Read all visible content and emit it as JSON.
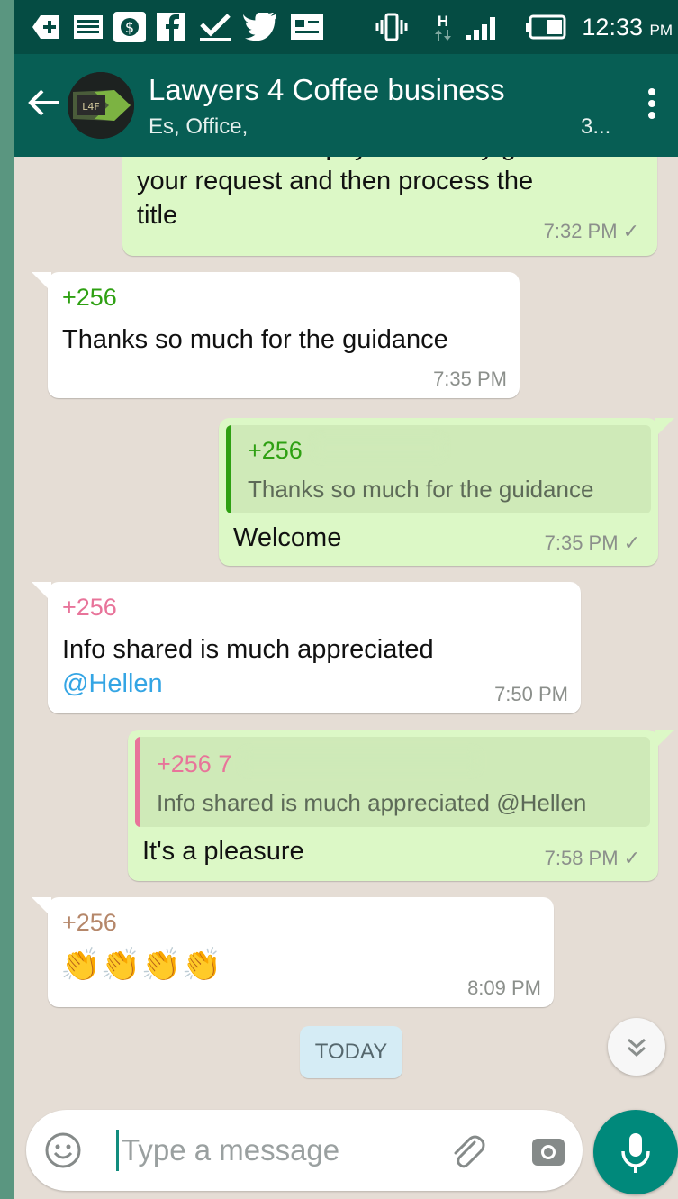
{
  "status_bar": {
    "icons": [
      "add-box-icon",
      "message-icon",
      "dollar-app-icon",
      "facebook-icon",
      "download-done-icon",
      "twitter-icon",
      "news-icon",
      "vibrate-icon",
      "h-network-icon",
      "signal-icon",
      "battery-icon"
    ],
    "network_label": "H",
    "time": "12:33",
    "ampm": "PM"
  },
  "header": {
    "title": "Lawyers 4 Coffee business",
    "subtitle": "Es, Office,",
    "subtitle_tail": "3...",
    "avatar_text": "L4F"
  },
  "messages": [
    {
      "type": "outgoing",
      "text_lines": [
        "assess the fees payable if they grant",
        "your request and then process the",
        "title"
      ],
      "time": "7:32 PM"
    },
    {
      "type": "incoming",
      "sender": "+256",
      "text": "Thanks so much for the guidance",
      "time": "7:35 PM"
    },
    {
      "type": "outgoing",
      "quote_sender": "+256",
      "quote_text": "Thanks so much for the guidance",
      "text": "Welcome",
      "time": "7:35 PM"
    },
    {
      "type": "incoming",
      "sender": "+256",
      "text": "Info shared is much appreciated",
      "mention": "@Hellen",
      "time": "7:50 PM"
    },
    {
      "type": "outgoing",
      "quote_sender": "+256 7",
      "quote_text": "Info shared is much appreciated @Hellen",
      "text": "It's a pleasure",
      "time": "7:58 PM"
    },
    {
      "type": "incoming",
      "sender": "+256",
      "emoji": "👏👏👏👏",
      "time": "8:09 PM"
    }
  ],
  "day_separator": "TODAY",
  "composer": {
    "placeholder": "Type a message"
  },
  "colors": {
    "header": "#075e54",
    "status_bar": "#054c43",
    "outgoing_bubble": "#dcf8c6",
    "incoming_bubble": "#ffffff",
    "chat_bg": "#e5ddd5",
    "mic_button": "#00897b",
    "sender_green": "#2ea012",
    "sender_pink": "#e8749a",
    "sender_brown": "#b5876a",
    "mention": "#34a5e4"
  }
}
